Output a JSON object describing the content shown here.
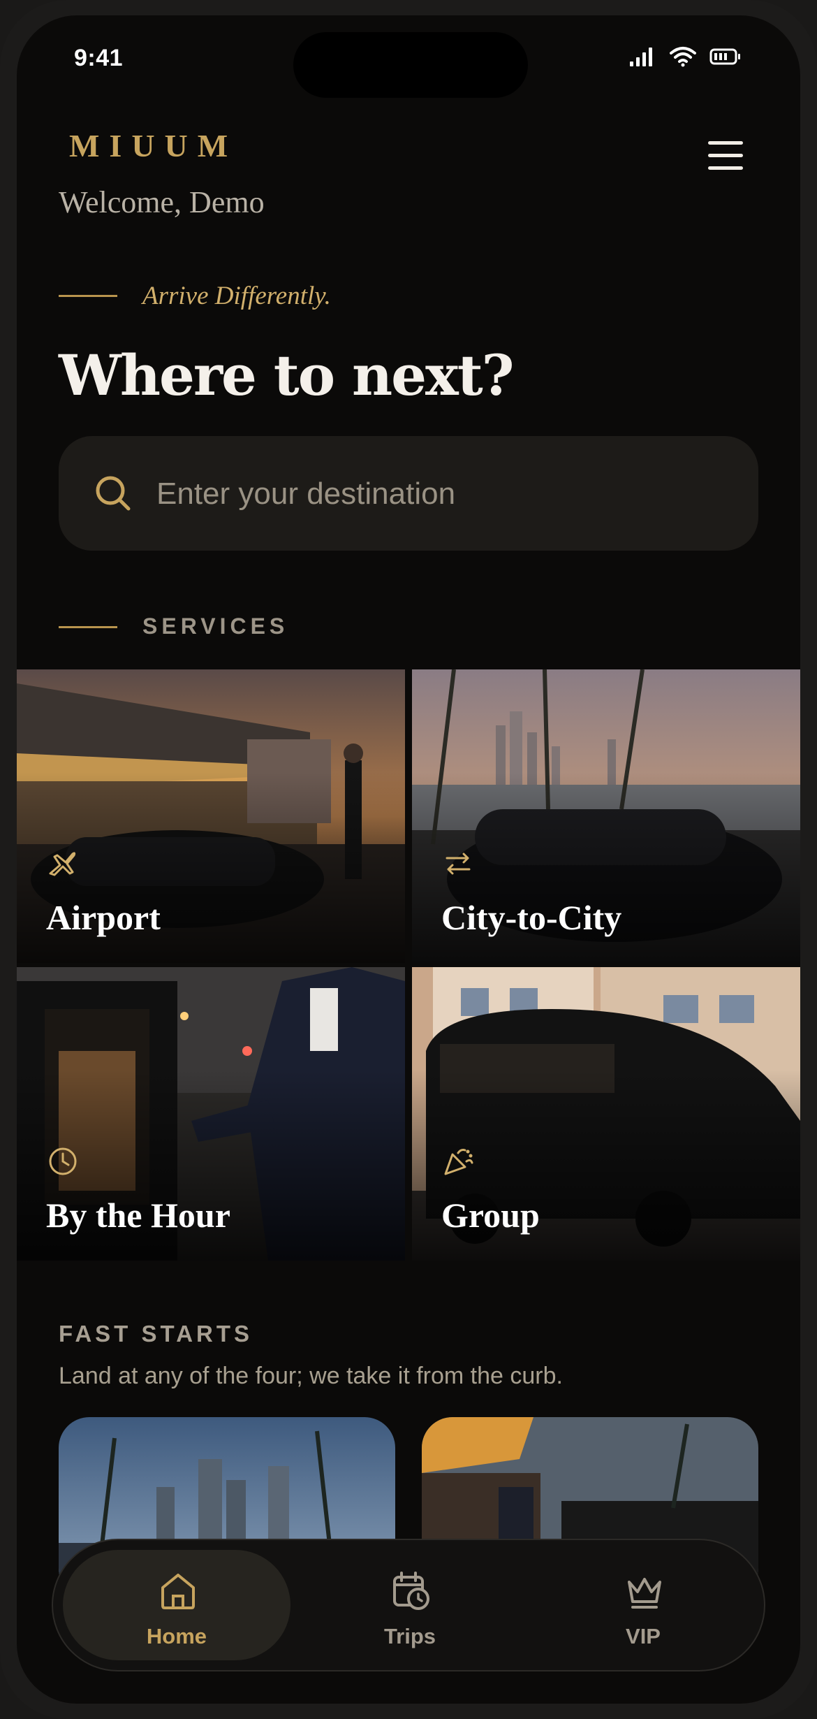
{
  "status_bar": {
    "time": "9:41"
  },
  "header": {
    "logo": "MIUUM",
    "welcome": "Welcome, Demo"
  },
  "hero": {
    "tagline": "Arrive Differently.",
    "headline": "Where to next?"
  },
  "search": {
    "placeholder": "Enter your destination",
    "icon": "search-icon"
  },
  "services": {
    "label": "SERVICES",
    "items": [
      {
        "label": "Airport",
        "icon": "plane-icon"
      },
      {
        "label": "City-to-City",
        "icon": "swap-arrows-icon"
      },
      {
        "label": "By the Hour",
        "icon": "clock-icon"
      },
      {
        "label": "Group",
        "icon": "party-popper-icon"
      }
    ]
  },
  "fast_starts": {
    "label": "FAST STARTS",
    "subtitle": "Land at any of the four; we take it from the curb."
  },
  "tab_bar": {
    "items": [
      {
        "label": "Home",
        "icon": "home-icon",
        "active": true
      },
      {
        "label": "Trips",
        "icon": "calendar-clock-icon",
        "active": false
      },
      {
        "label": "VIP",
        "icon": "crown-icon",
        "active": false
      }
    ]
  },
  "colors": {
    "accent_gold": "#c7a45e",
    "background": "#0b0a09",
    "text_light": "#f4f0ea",
    "tab_inactive": "#a39b8e"
  }
}
